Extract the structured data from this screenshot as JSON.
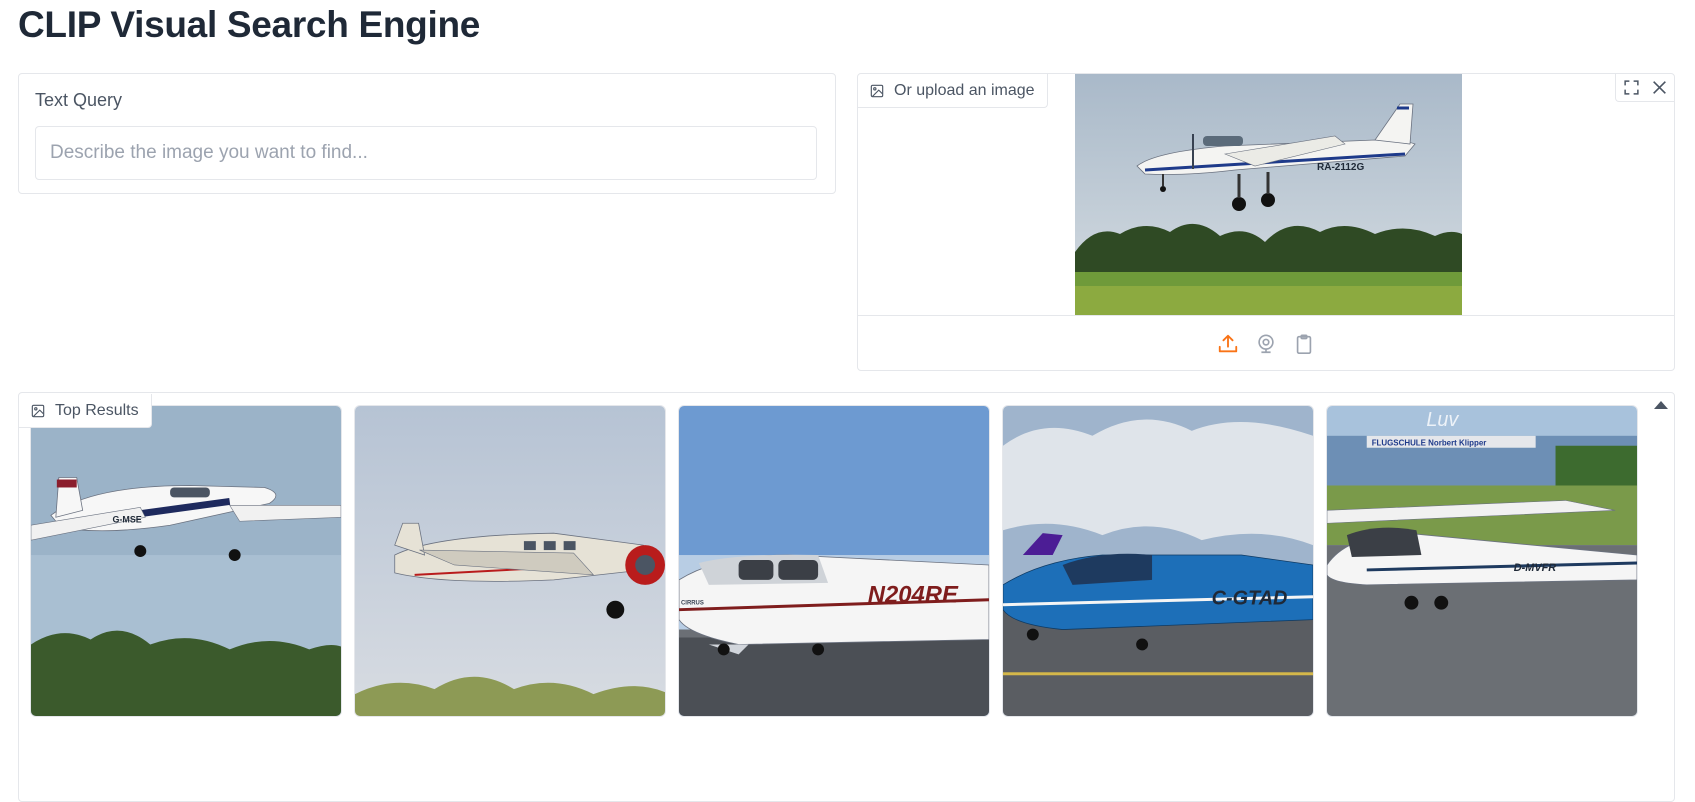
{
  "header": {
    "title": "CLIP Visual Search Engine"
  },
  "text_query": {
    "label": "Text Query",
    "placeholder": "Describe the image you want to find...",
    "value": ""
  },
  "image_upload": {
    "label": "Or upload an image",
    "registration": "RA-2112G",
    "icons": [
      "image-icon",
      "fullscreen-icon",
      "close-icon",
      "upload-icon",
      "webcam-icon",
      "clipboard-icon"
    ],
    "accent_color": "#f97316"
  },
  "results": {
    "label": "Top Results",
    "items": [
      {
        "registration": "G-MSE"
      },
      {
        "registration": ""
      },
      {
        "registration": "N204RE",
        "maker": "CIRRUS"
      },
      {
        "registration": "C-GTAD"
      },
      {
        "registration": "D-MVFR",
        "sign": "FLUGSCHULE Norbert Klipper",
        "hangar_text": "Luv"
      }
    ]
  }
}
